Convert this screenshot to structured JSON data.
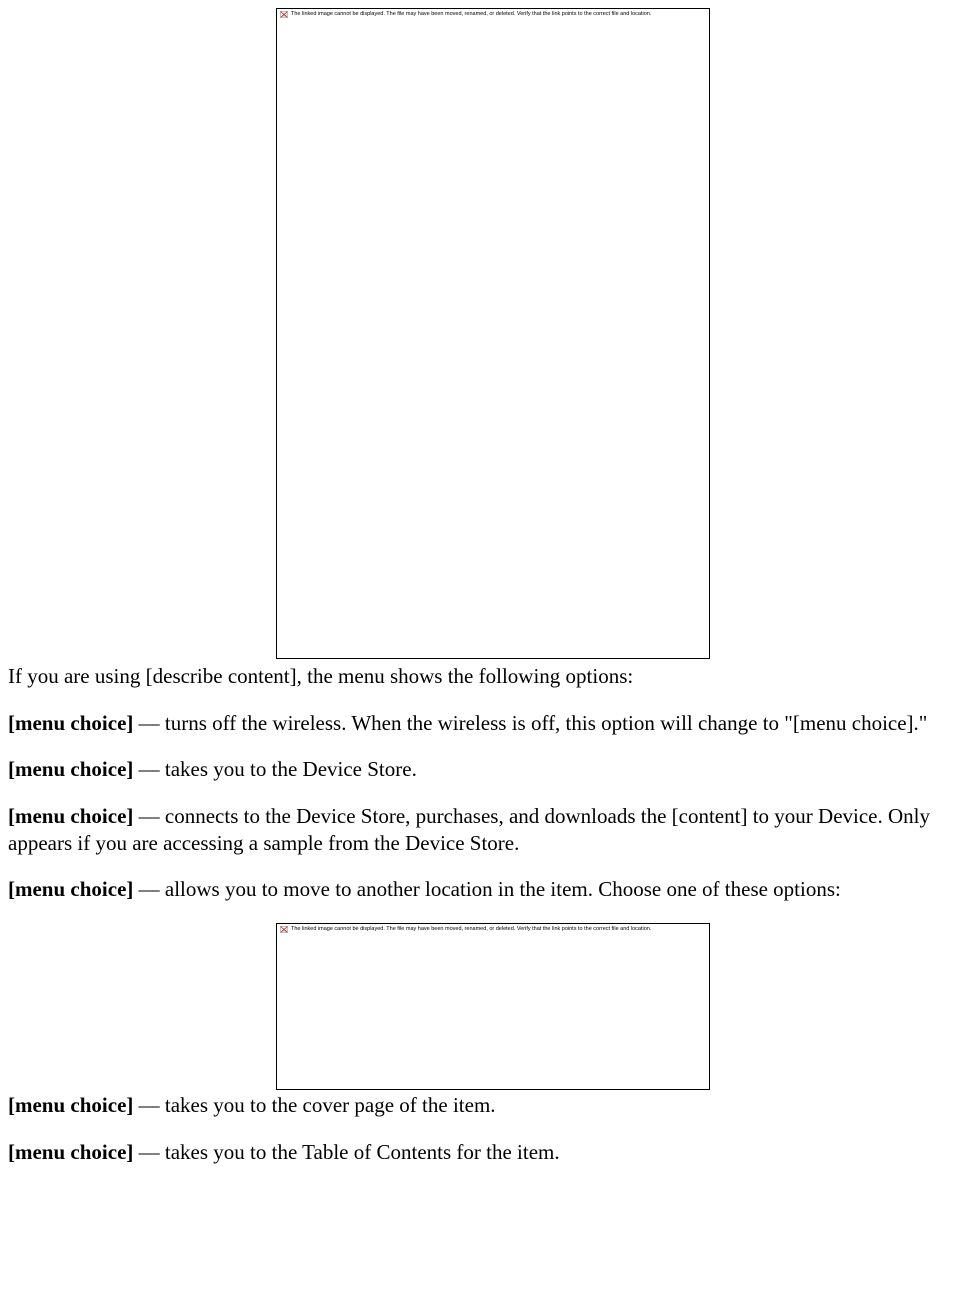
{
  "broken_text": "The linked image cannot be displayed.  The file may have been moved, renamed, or deleted. Verify that the link points to the correct file and location.",
  "intro": "If you are using [describe content], the menu shows the following options:",
  "items": [
    {
      "label": "[menu choice]",
      "desc": " — turns off the wireless. When the wireless is off, this option will change to \"[menu choice].\""
    },
    {
      "label": "[menu choice]",
      "desc": " — takes you to the Device Store."
    },
    {
      "label": "[menu choice]",
      "desc": " — connects to the Device Store, purchases, and downloads the [content] to your Device. Only appears if you are accessing a sample from the Device Store."
    },
    {
      "label": "[menu choice]",
      "desc": " — allows you to move to another location in the item. Choose one of these options:"
    },
    {
      "label": "[menu choice]",
      "desc": " — takes you to the cover page of the item."
    },
    {
      "label": "[menu choice]",
      "desc": " — takes you to the Table of Contents for the item."
    }
  ]
}
